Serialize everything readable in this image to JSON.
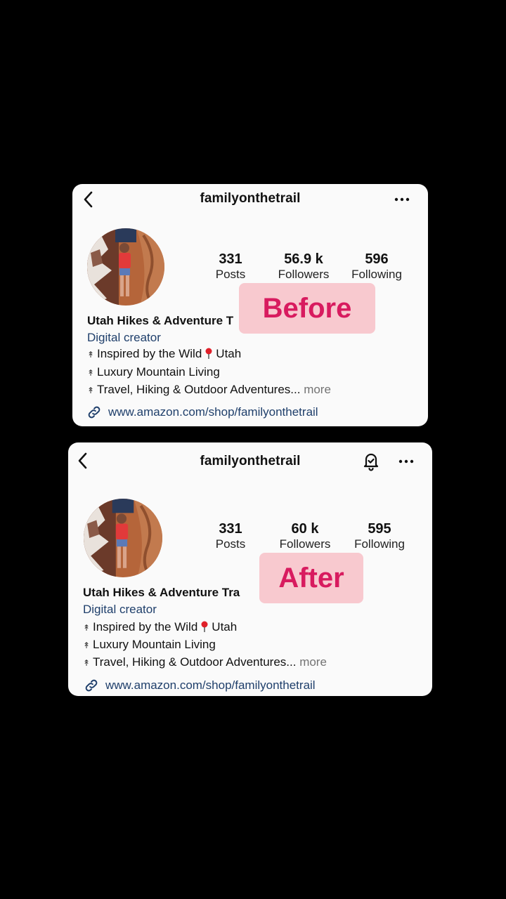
{
  "before": {
    "username": "familyonthetrail",
    "stats": {
      "posts_value": "331",
      "posts_label": "Posts",
      "followers_value": "56.9 k",
      "followers_label": "Followers",
      "following_value": "596",
      "following_label": "Following"
    },
    "bio": {
      "name": "Utah Hikes & Adventure T",
      "category": "Digital creator",
      "line1_a": "Inspired by the Wild",
      "line1_b": "Utah",
      "line2": "Luxury Mountain Living",
      "line3": "Travel, Hiking & Outdoor Adventures...",
      "more": "more"
    },
    "link": "www.amazon.com/shop/familyonthetrail",
    "tag": "Before"
  },
  "after": {
    "username": "familyonthetrail",
    "stats": {
      "posts_value": "331",
      "posts_label": "Posts",
      "followers_value": "60 k",
      "followers_label": "Followers",
      "following_value": "595",
      "following_label": "Following"
    },
    "bio": {
      "name": "Utah Hikes & Adventure Tra",
      "category": "Digital creator",
      "line1_a": "Inspired by the Wild",
      "line1_b": "Utah",
      "line2": "Luxury Mountain Living",
      "line3": "Travel, Hiking & Outdoor Adventures...",
      "more": "more"
    },
    "link": "www.amazon.com/shop/familyonthetrail",
    "tag": "After"
  },
  "icons": {
    "back": "chevron-left-icon",
    "more": "more-horizontal-icon",
    "bell": "bell-icon",
    "link": "link-icon",
    "pin": "map-pin-icon",
    "bullet": "tree-icon"
  },
  "colors": {
    "card_bg": "#fafafa",
    "page_bg": "#000000",
    "tag_bg": "#f8c9cf",
    "tag_text": "#d81b5f",
    "link": "#1f3f6b",
    "pin": "#e0202a"
  }
}
